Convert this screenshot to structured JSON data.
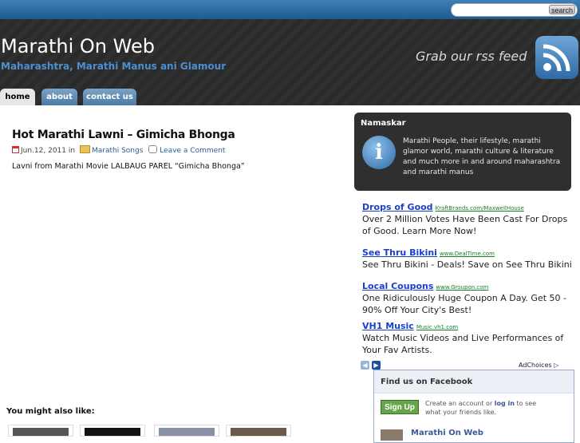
{
  "search": {
    "button_label": "search",
    "placeholder": ""
  },
  "site": {
    "title": "Marathi On Web",
    "tagline": "Maharashtra, Marathi Manus ani Glamour"
  },
  "rss": {
    "text": "Grab our rss feed",
    "icon": "rss-icon"
  },
  "nav": {
    "tabs": [
      {
        "label": "home",
        "active": true
      },
      {
        "label": "about",
        "active": false
      },
      {
        "label": "contact us",
        "active": false
      }
    ]
  },
  "post": {
    "title": "Hot Marathi Lawni – Gimicha Bhonga",
    "date": "Jun.12, 2011",
    "in_word": "in",
    "category": "Marathi Songs",
    "comment_link": "Leave a Comment",
    "body": "Lavni from Marathi Movie LALBAUG PAREL “Gimicha Bhonga”"
  },
  "related": {
    "heading": "You might also like:"
  },
  "sidebar": {
    "info": {
      "title": "Namaskar",
      "text": "Marathi People, their lifestyle, marathi glamor world, marathi culture & literature and much more in and around maharashtra and marathi manus"
    },
    "ads": [
      {
        "title": "Drops of Good",
        "url": "KraftBrands.com/MaxwellHouse",
        "desc": "Over 2 Million Votes Have Been Cast For Drops of Good. Learn More Now!"
      },
      {
        "title": "See Thru Bikini",
        "url": "www.DealTime.com",
        "desc": "See Thru Bikini - Deals! Save on See Thru Bikini"
      },
      {
        "title": "Local Coupons",
        "url": "www.Groupon.com",
        "desc": "One Ridiculously Huge Coupon A Day. Get 50 - 90% Off Your City's Best!"
      },
      {
        "title": "VH1 Music",
        "url": "Music.vh1.com",
        "desc": "Watch Music Videos and Live Performances of Your Fav Artists."
      }
    ],
    "adchoices": "AdChoices",
    "facebook": {
      "heading": "Find us on Facebook",
      "signup": "Sign Up",
      "create_pre": "Create an account or",
      "login": "log in",
      "create_post": "to see what your friends like.",
      "page_name": "Marathi On Web"
    }
  },
  "colors": {
    "link": "#1a3fcf",
    "ad_url": "#1a7d2a",
    "tagline": "#4b8fd0",
    "header_bg": "#2a2a2a"
  }
}
